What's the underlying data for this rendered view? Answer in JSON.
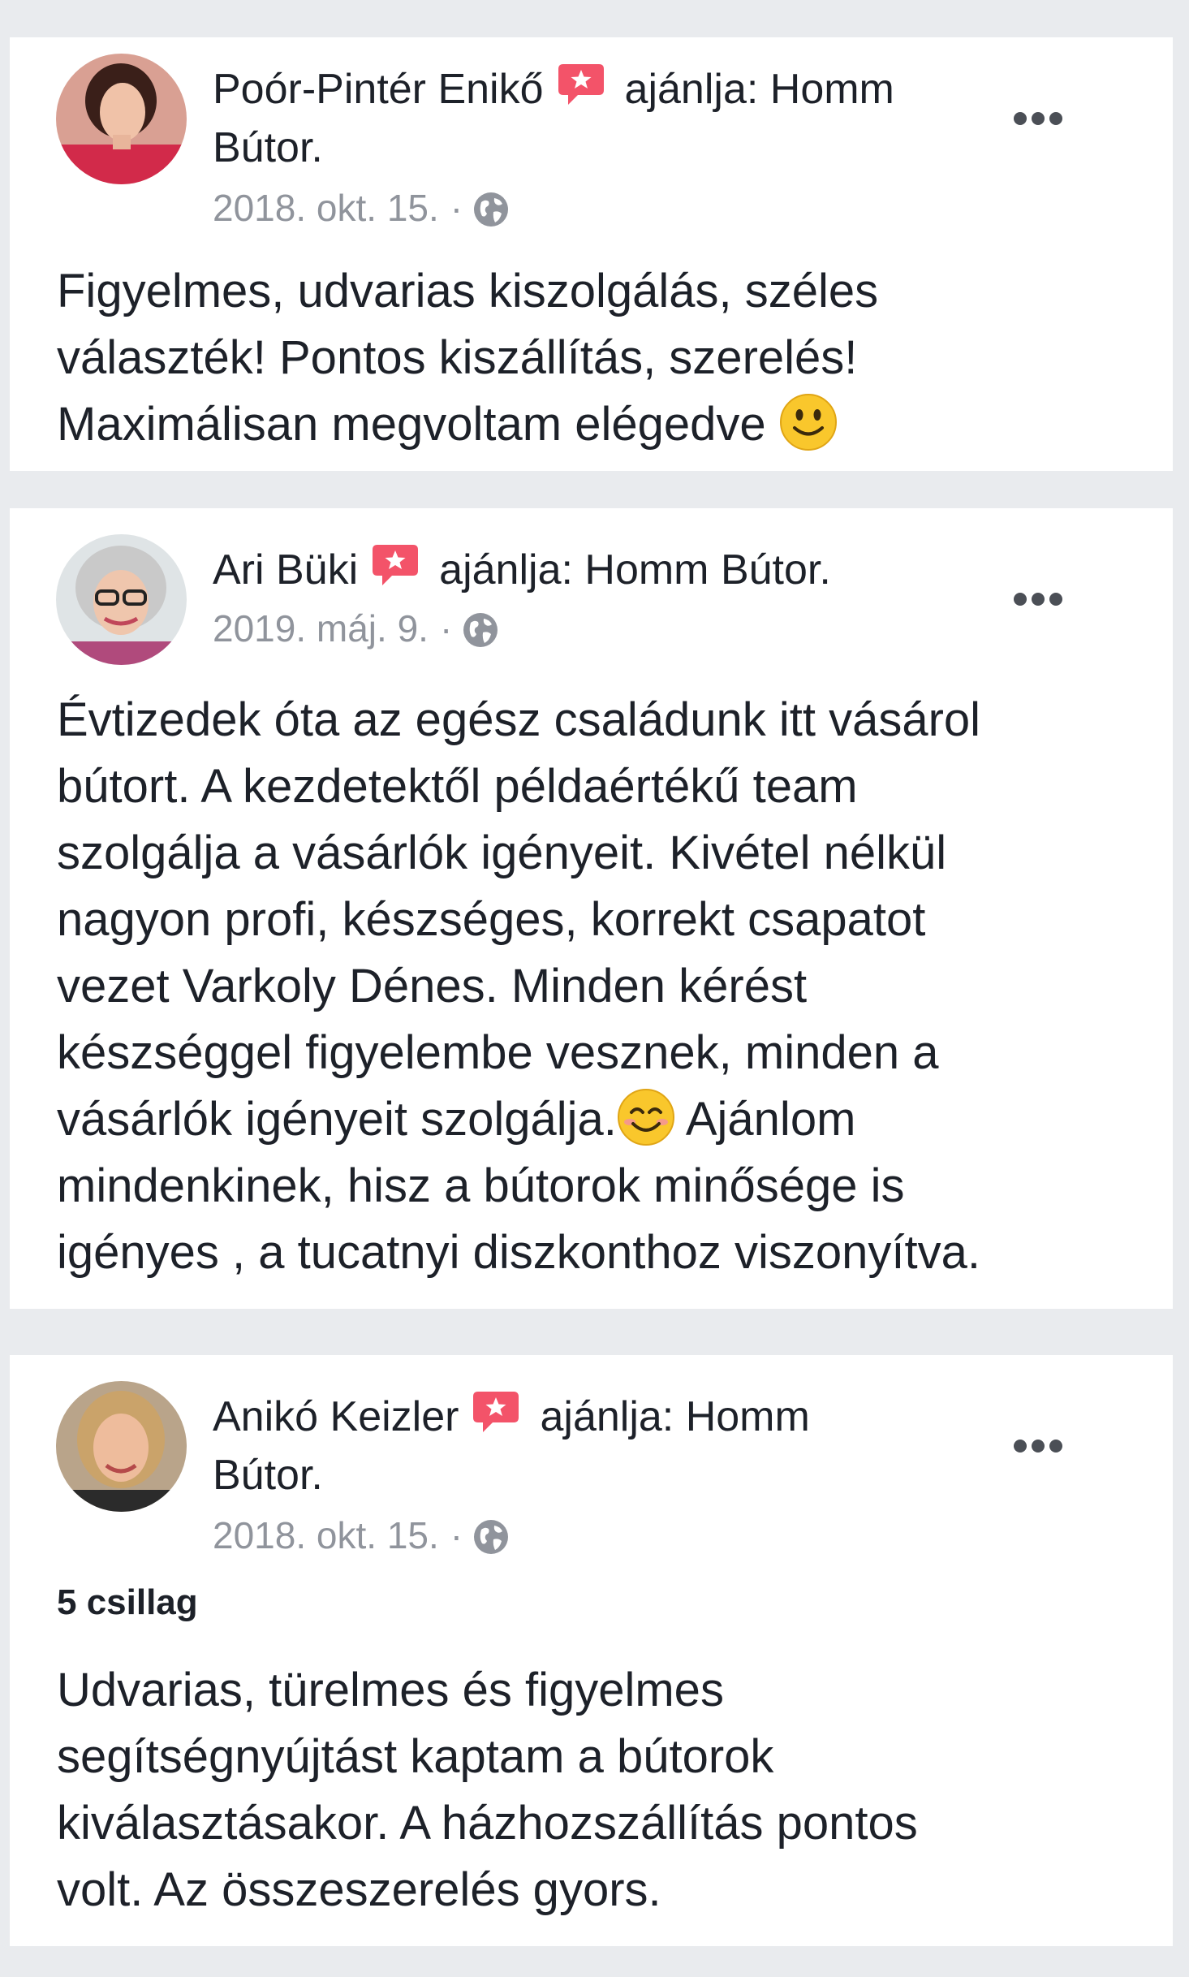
{
  "colors": {
    "background": "#e9ebee",
    "card": "#ffffff",
    "text": "#1d2129",
    "meta": "#90949c",
    "recommend_badge": "#f35369"
  },
  "reviews": [
    {
      "author": "Poór-Pintér Enikő",
      "recommend_text": "ajánlja: Homm",
      "recommend_text_cont": "Bútor.",
      "date": "2018. okt. 15.",
      "separator": "·",
      "privacy_icon": "globe-icon",
      "lines": [
        "Figyelmes, udvarias kiszolgálás, széles",
        "választék! Pontos kiszállítás, szerelés!",
        "Maximálisan megvoltam elégedve"
      ],
      "trailing_emoji": "slightly-smiling-face"
    },
    {
      "author": "Ari Büki",
      "recommend_text": "ajánlja: Homm Bútor.",
      "date": "2019. máj. 9.",
      "separator": "·",
      "privacy_icon": "globe-icon",
      "lines": [
        "Évtizedek óta az egész családunk itt vásárol",
        "bútort. A kezdetektől példaértékű team",
        "szolgálja a vásárlók igényeit. Kivétel nélkül",
        "nagyon profi, készséges, korrekt csapatot",
        "vezet Varkoly Dénes. Minden kérést",
        "készséggel figyelembe vesznek, minden a",
        "vásárlók igényeit szolgálja.",
        "Ajánlom",
        "mindenkinek, hisz a bútorok minősége is",
        "igényes , a tucatnyi diszkonthoz viszonyítva."
      ],
      "inline_emoji": "smiling-face-with-smiling-eyes"
    },
    {
      "author": "Anikó Keizler",
      "recommend_text": "ajánlja: Homm",
      "recommend_text_cont": "Bútor.",
      "date": "2018. okt. 15.",
      "separator": "·",
      "privacy_icon": "globe-icon",
      "rating": "5 csillag",
      "lines": [
        "Udvarias, türelmes és figyelmes",
        "segítségnyújtást kaptam a bútorok",
        "kiválasztásakor. A házhozszállítás pontos",
        "volt. Az összeszerelés gyors."
      ]
    }
  ]
}
